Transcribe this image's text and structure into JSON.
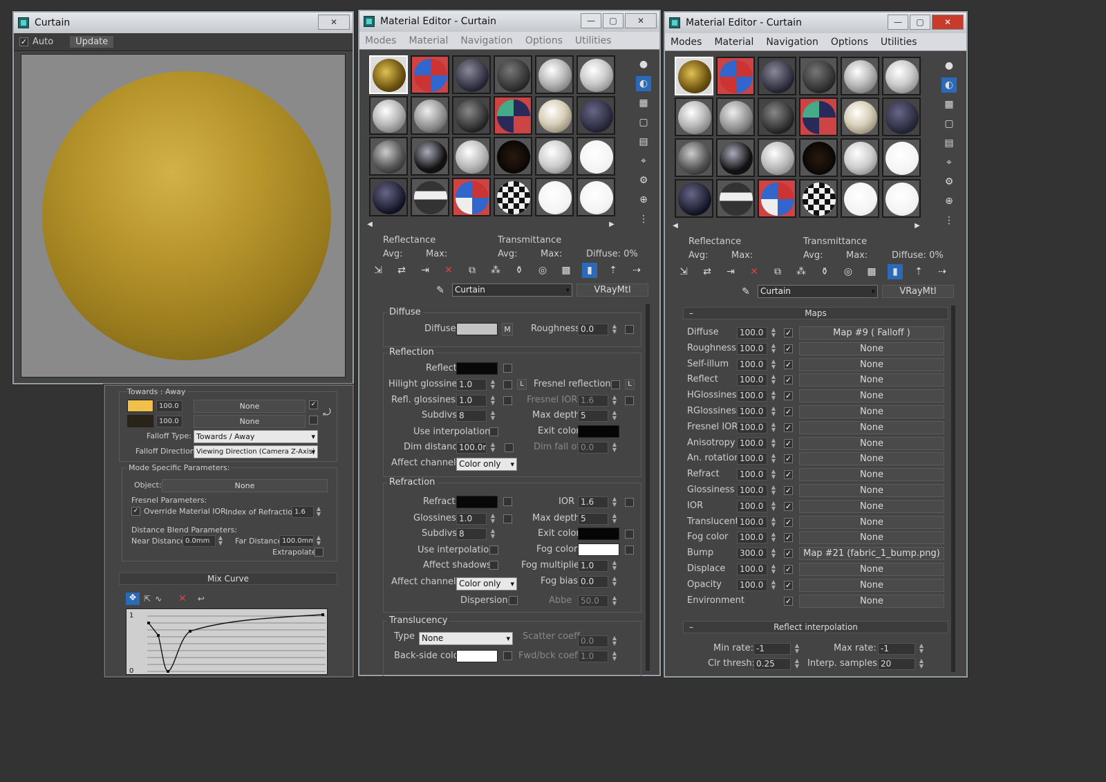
{
  "preview_window": {
    "title": "Curtain",
    "close_glyph": "✕",
    "auto_label": "Auto",
    "update_label": "Update",
    "sphere_color": "#b89a2c"
  },
  "falloff_panel": {
    "header": "Towards : Away",
    "row1": {
      "value": "100.0",
      "map": "None",
      "color": "#f1c04a"
    },
    "row2": {
      "value": "100.0",
      "map": "None",
      "color": "#2a2418"
    },
    "falloff_type_label": "Falloff Type:",
    "falloff_type_value": "Towards / Away",
    "falloff_dir_label": "Falloff Direction:",
    "falloff_dir_value": "Viewing Direction (Camera Z-Axis)",
    "mode_params_title": "Mode Specific Parameters:",
    "object_label": "Object:",
    "object_value": "None",
    "fresnel_title": "Fresnel Parameters:",
    "override_ior_label": "Override Material IOR",
    "index_refraction_label": "Index of Refraction",
    "index_refraction_value": "1.6",
    "distance_title": "Distance Blend Parameters:",
    "near_label": "Near Distance:",
    "near_value": "0.0mm",
    "far_label": "Far Distance:",
    "far_value": "100.0mm",
    "extrapolate_label": "Extrapolate",
    "mix_curve_label": "Mix Curve",
    "axis_top": "1",
    "axis_bottom": "0"
  },
  "editor_left": {
    "title": "Material Editor - Curtain",
    "menu": [
      "Modes",
      "Material",
      "Navigation",
      "Options",
      "Utilities"
    ],
    "reflectance": "Reflectance",
    "transmittance": "Transmittance",
    "avg": "Avg:",
    "max": "Max:",
    "avg2": "Avg:",
    "max2": "Max:",
    "diffuse_pct": "Diffuse:   0%",
    "material_name": "Curtain",
    "material_type": "VRayMtl",
    "diffuse_group": "Diffuse",
    "diffuse_label": "Diffuse",
    "m_label": "M",
    "roughness_label": "Roughness",
    "roughness_value": "0.0",
    "reflection_group": "Reflection",
    "reflect_label": "Reflect",
    "hilight_label": "Hilight glossiness",
    "hilight_value": "1.0",
    "l_label": "L",
    "fresnel_label": "Fresnel reflections",
    "refl_gloss_label": "Refl. glossiness",
    "refl_gloss_value": "1.0",
    "fresnel_ior_label": "Fresnel IOR",
    "fresnel_ior_value": "1.6",
    "subdivs_label": "Subdivs",
    "subdivs_value": "8",
    "max_depth_label": "Max depth",
    "max_depth_value": "5",
    "use_interp_label": "Use interpolation",
    "exit_color_label": "Exit color",
    "dim_distance_label": "Dim distance",
    "dim_distance_value": "100.0m",
    "dim_falloff_label": "Dim fall off",
    "dim_falloff_value": "0.0",
    "affect_channels_label": "Affect channels",
    "affect_channels_value": "Color only",
    "refraction_group": "Refraction",
    "refract_label": "Refract",
    "ior_label": "IOR",
    "ior_value": "1.6",
    "glossiness_label": "Glossiness",
    "glossiness_value": "1.0",
    "r_max_depth_label": "Max depth",
    "r_max_depth_value": "5",
    "r_subdivs_label": "Subdivs",
    "r_subdivs_value": "8",
    "r_exit_color_label": "Exit color",
    "r_use_interp_label": "Use interpolation",
    "fog_color_label": "Fog color",
    "affect_shadows_label": "Affect shadows",
    "fog_mult_label": "Fog multiplier",
    "fog_mult_value": "1.0",
    "r_affect_channels_label": "Affect channels",
    "r_affect_channels_value": "Color only",
    "fog_bias_label": "Fog bias",
    "fog_bias_value": "0.0",
    "dispersion_label": "Dispersion",
    "abbe_label": "Abbe",
    "abbe_value": "50.0",
    "translucency_group": "Translucency",
    "type_label": "Type",
    "type_value": "None",
    "scatter_label": "Scatter coeff",
    "scatter_value": "0.0",
    "backside_label": "Back-side color",
    "fwd_label": "Fwd/bck coeff",
    "fwd_value": "1.0"
  },
  "editor_right": {
    "title": "Material Editor - Curtain",
    "menu": [
      "Modes",
      "Material",
      "Navigation",
      "Options",
      "Utilities"
    ],
    "reflectance": "Reflectance",
    "transmittance": "Transmittance",
    "avg": "Avg:",
    "max": "Max:",
    "avg2": "Avg:",
    "max2": "Max:",
    "diffuse_pct": "Diffuse:   0%",
    "material_name": "Curtain",
    "material_type": "VRayMtl",
    "maps_title": "Maps",
    "collapse": "–",
    "maps": [
      {
        "name": "Diffuse",
        "value": "100.0",
        "map": "Map #9  ( Falloff )"
      },
      {
        "name": "Roughness",
        "value": "100.0",
        "map": "None"
      },
      {
        "name": "Self-illum",
        "value": "100.0",
        "map": "None"
      },
      {
        "name": "Reflect",
        "value": "100.0",
        "map": "None"
      },
      {
        "name": "HGlossiness",
        "value": "100.0",
        "map": "None"
      },
      {
        "name": "RGlossiness",
        "value": "100.0",
        "map": "None"
      },
      {
        "name": "Fresnel IOR",
        "value": "100.0",
        "map": "None"
      },
      {
        "name": "Anisotropy",
        "value": "100.0",
        "map": "None"
      },
      {
        "name": "An. rotation",
        "value": "100.0",
        "map": "None"
      },
      {
        "name": "Refract",
        "value": "100.0",
        "map": "None"
      },
      {
        "name": "Glossiness",
        "value": "100.0",
        "map": "None"
      },
      {
        "name": "IOR",
        "value": "100.0",
        "map": "None"
      },
      {
        "name": "Translucent",
        "value": "100.0",
        "map": "None"
      },
      {
        "name": "Fog color",
        "value": "100.0",
        "map": "None"
      },
      {
        "name": "Bump",
        "value": "300.0",
        "map": "Map #21 (fabric_1_bump.png)"
      },
      {
        "name": "Displace",
        "value": "100.0",
        "map": "None"
      },
      {
        "name": "Opacity",
        "value": "100.0",
        "map": "None"
      },
      {
        "name": "Environment",
        "value": "",
        "map": "None"
      }
    ],
    "reflect_interp_title": "Reflect interpolation",
    "min_rate_label": "Min rate:",
    "min_rate_value": "-1",
    "max_rate_label": "Max rate:",
    "max_rate_value": "-1",
    "clr_thresh_label": "Clr thresh:",
    "clr_thresh_value": "0.25",
    "interp_samples_label": "Interp. samples:",
    "interp_samples_value": "20"
  }
}
